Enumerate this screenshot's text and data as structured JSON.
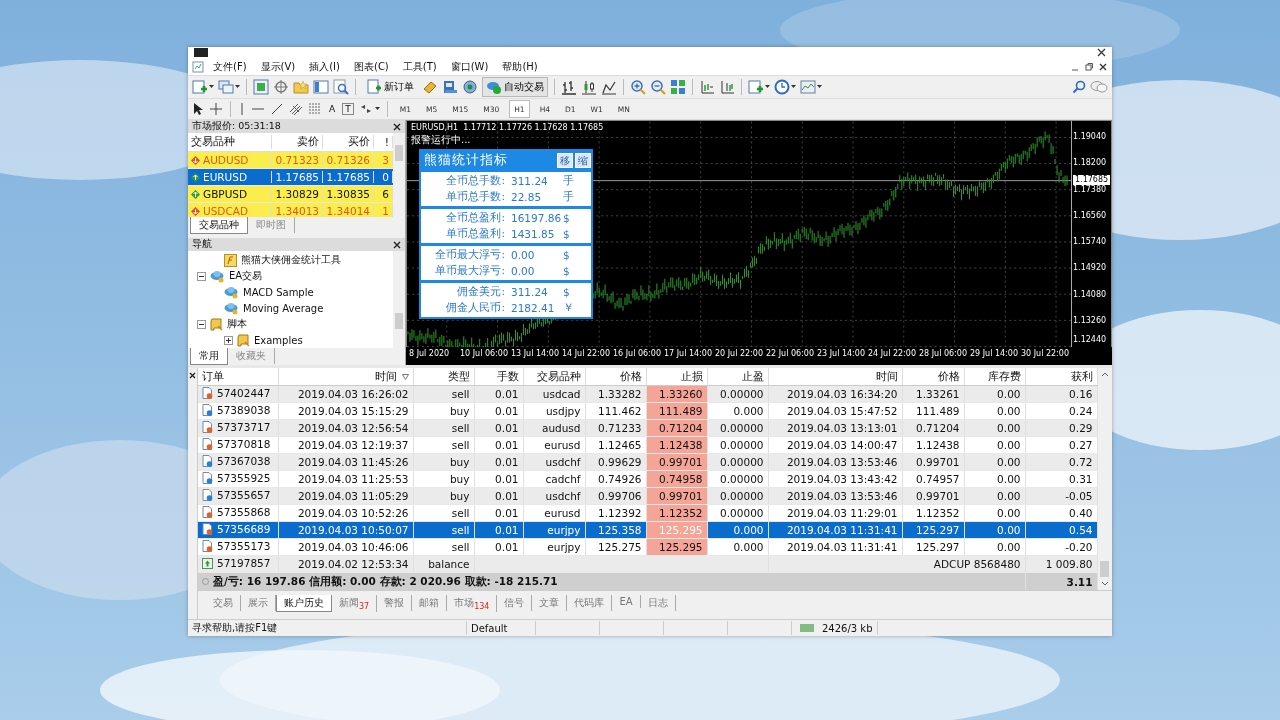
{
  "menu": [
    "文件(F)",
    "显示(V)",
    "插入(I)",
    "图表(C)",
    "工具(T)",
    "窗口(W)",
    "帮助(H)"
  ],
  "toolbar": {
    "new_order": "新订单",
    "auto_trading": {
      "label": "自动交易",
      "on": true
    }
  },
  "drawing_tools": {
    "text_tools": [
      "A",
      "T"
    ]
  },
  "timeframes": [
    {
      "label": "M1",
      "selected": false
    },
    {
      "label": "M5",
      "selected": false
    },
    {
      "label": "M15",
      "selected": false
    },
    {
      "label": "M30",
      "selected": false
    },
    {
      "label": "H1",
      "selected": true
    },
    {
      "label": "H4",
      "selected": false
    },
    {
      "label": "D1",
      "selected": false
    },
    {
      "label": "W1",
      "selected": false
    },
    {
      "label": "MN",
      "selected": false
    }
  ],
  "market_watch": {
    "title": "市场报价: 05:31:18",
    "columns": [
      "交易品种",
      "卖价",
      "买价",
      "!"
    ],
    "rows": [
      {
        "symbol": "AUDUSD",
        "bid": "0.71323",
        "ask": "0.71326",
        "spread": "3",
        "kind": "down",
        "selected": false
      },
      {
        "symbol": "EURUSD",
        "bid": "1.17685",
        "ask": "1.17685",
        "spread": "0",
        "kind": "up",
        "selected": true
      },
      {
        "symbol": "GBPUSD",
        "bid": "1.30829",
        "ask": "1.30835",
        "spread": "6",
        "kind": "up",
        "selected": false
      },
      {
        "symbol": "USDCAD",
        "bid": "1.34013",
        "ask": "1.34014",
        "spread": "1",
        "kind": "down",
        "selected": false
      }
    ],
    "tabs": [
      {
        "label": "交易品种",
        "selected": true
      },
      {
        "label": "即时图",
        "selected": false
      }
    ]
  },
  "navigator": {
    "title": "导航",
    "tree": [
      {
        "label": "熊猫大侠佣金统计工具",
        "kind": "indicator"
      },
      {
        "label": "EA交易",
        "kind": "expert",
        "expanded": true,
        "children": [
          {
            "label": "MACD Sample",
            "kind": "expert"
          },
          {
            "label": "Moving Average",
            "kind": "expert"
          }
        ]
      },
      {
        "label": "脚本",
        "kind": "script",
        "expanded": true,
        "children": [
          {
            "label": "Examples",
            "kind": "script",
            "expanded": false
          }
        ]
      }
    ],
    "tabs": [
      {
        "label": "常用",
        "selected": true
      },
      {
        "label": "收藏夹",
        "selected": false
      }
    ]
  },
  "chart": {
    "header": "EURUSD,H1  1.17712 1.17726 1.17628 1.17685",
    "status": "报警运行中...",
    "current_price": "1.17685",
    "price_labels": [
      "1.19040",
      "1.18200",
      "1.17380",
      "1.16560",
      "1.15740",
      "1.14920",
      "1.14080",
      "1.13260",
      "1.12440"
    ],
    "time_labels": [
      "8 Jul 2020",
      "10 Jul 06:00",
      "13 Jul 14:00",
      "14 Jul 22:00",
      "16 Jul 06:00",
      "17 Jul 14:00",
      "20 Jul 22:00",
      "22 Jul 06:00",
      "23 Jul 14:00",
      "24 Jul 22:00",
      "28 Jul 06:00",
      "29 Jul 14:00",
      "30 Jul 22:00"
    ]
  },
  "stats_panel": {
    "title": "熊猫统计指标",
    "buttons": [
      "移",
      "缩"
    ],
    "groups": [
      {
        "rows": [
          {
            "label": "全币总手数:",
            "value": "311.24",
            "unit": "手"
          },
          {
            "label": "单币总手数:",
            "value": "22.85",
            "unit": "手"
          }
        ]
      },
      {
        "rows": [
          {
            "label": "全币总盈利:",
            "value": "16197.86",
            "unit": "$"
          },
          {
            "label": "单币总盈利:",
            "value": "1431.85",
            "unit": "$"
          }
        ]
      },
      {
        "rows": [
          {
            "label": "全币最大浮亏:",
            "value": "0.00",
            "unit": "$"
          },
          {
            "label": "单币最大浮亏:",
            "value": "0.00",
            "unit": "$"
          }
        ]
      },
      {
        "rows": [
          {
            "label": "佣金美元:",
            "value": "311.24",
            "unit": "$"
          },
          {
            "label": "佣金人民币:",
            "value": "2182.41",
            "unit": "￥"
          }
        ]
      }
    ]
  },
  "terminal": {
    "columns": [
      "订单",
      "时间",
      "类型",
      "手数",
      "交易品种",
      "价格",
      "止损",
      "止盈",
      "时间",
      "价格",
      "库存费",
      "获利"
    ],
    "rows": [
      {
        "kind": "sell",
        "selected": false,
        "order": "57402447",
        "open_time": "2019.04.03 16:26:02",
        "type": "sell",
        "size": "0.01",
        "symbol": "usdcad",
        "price": "1.33282",
        "sl": "1.33260",
        "tp": "0.00000",
        "close_time": "2019.04.03 16:34:20",
        "close_price": "1.33261",
        "swap": "0.00",
        "profit": "0.16"
      },
      {
        "kind": "buy",
        "selected": false,
        "order": "57389038",
        "open_time": "2019.04.03 15:15:29",
        "type": "buy",
        "size": "0.01",
        "symbol": "usdjpy",
        "price": "111.462",
        "sl": "111.489",
        "tp": "0.000",
        "close_time": "2019.04.03 15:47:52",
        "close_price": "111.489",
        "swap": "0.00",
        "profit": "0.24"
      },
      {
        "kind": "sell",
        "selected": false,
        "order": "57373717",
        "open_time": "2019.04.03 12:56:54",
        "type": "sell",
        "size": "0.01",
        "symbol": "audusd",
        "price": "0.71233",
        "sl": "0.71204",
        "tp": "0.00000",
        "close_time": "2019.04.03 13:13:01",
        "close_price": "0.71204",
        "swap": "0.00",
        "profit": "0.29"
      },
      {
        "kind": "sell",
        "selected": false,
        "order": "57370818",
        "open_time": "2019.04.03 12:19:37",
        "type": "sell",
        "size": "0.01",
        "symbol": "eurusd",
        "price": "1.12465",
        "sl": "1.12438",
        "tp": "0.00000",
        "close_time": "2019.04.03 14:00:47",
        "close_price": "1.12438",
        "swap": "0.00",
        "profit": "0.27"
      },
      {
        "kind": "buy",
        "selected": false,
        "order": "57367038",
        "open_time": "2019.04.03 11:45:26",
        "type": "buy",
        "size": "0.01",
        "symbol": "usdchf",
        "price": "0.99629",
        "sl": "0.99701",
        "tp": "0.00000",
        "close_time": "2019.04.03 13:53:46",
        "close_price": "0.99701",
        "swap": "0.00",
        "profit": "0.72"
      },
      {
        "kind": "buy",
        "selected": false,
        "order": "57355925",
        "open_time": "2019.04.03 11:25:53",
        "type": "buy",
        "size": "0.01",
        "symbol": "cadchf",
        "price": "0.74926",
        "sl": "0.74958",
        "tp": "0.00000",
        "close_time": "2019.04.03 13:43:42",
        "close_price": "0.74957",
        "swap": "0.00",
        "profit": "0.31"
      },
      {
        "kind": "buy",
        "selected": false,
        "order": "57355657",
        "open_time": "2019.04.03 11:05:29",
        "type": "buy",
        "size": "0.01",
        "symbol": "usdchf",
        "price": "0.99706",
        "sl": "0.99701",
        "tp": "0.00000",
        "close_time": "2019.04.03 13:53:46",
        "close_price": "0.99701",
        "swap": "0.00",
        "profit": "-0.05"
      },
      {
        "kind": "sell",
        "selected": false,
        "order": "57355868",
        "open_time": "2019.04.03 10:52:26",
        "type": "sell",
        "size": "0.01",
        "symbol": "eurusd",
        "price": "1.12392",
        "sl": "1.12352",
        "tp": "0.00000",
        "close_time": "2019.04.03 11:29:01",
        "close_price": "1.12352",
        "swap": "0.00",
        "profit": "0.40"
      },
      {
        "kind": "sell",
        "selected": true,
        "order": "57356689",
        "open_time": "2019.04.03 10:50:07",
        "type": "sell",
        "size": "0.01",
        "symbol": "eurjpy",
        "price": "125.358",
        "sl": "125.295",
        "tp": "0.000",
        "close_time": "2019.04.03 11:31:41",
        "close_price": "125.297",
        "swap": "0.00",
        "profit": "0.54"
      },
      {
        "kind": "sell",
        "selected": false,
        "order": "57355173",
        "open_time": "2019.04.03 10:46:06",
        "type": "sell",
        "size": "0.01",
        "symbol": "eurjpy",
        "price": "125.275",
        "sl": "125.295",
        "tp": "0.000",
        "close_time": "2019.04.03 11:31:41",
        "close_price": "125.297",
        "swap": "0.00",
        "profit": "-0.20"
      },
      {
        "kind": "balance",
        "selected": false,
        "order": "57197857",
        "open_time": "2019.04.02 12:53:34",
        "type": "balance",
        "comment": "ADCUP 8568480",
        "profit": "1 009.80"
      }
    ],
    "summary": {
      "text": "盈/亏: 16 197.86  信用额: 0.00  存款: 2 020.96  取款: -18 215.71",
      "profit": "3.11"
    },
    "tabs": [
      {
        "label": "交易",
        "selected": false
      },
      {
        "label": "展示",
        "selected": false
      },
      {
        "label": "账户历史",
        "selected": true
      },
      {
        "label": "新闻",
        "badge": "37",
        "selected": false
      },
      {
        "label": "警报",
        "selected": false
      },
      {
        "label": "邮箱",
        "selected": false
      },
      {
        "label": "市场",
        "badge": "134",
        "selected": false
      },
      {
        "label": "信号",
        "selected": false
      },
      {
        "label": "文章",
        "selected": false
      },
      {
        "label": "代码库",
        "selected": false
      },
      {
        "label": "EA",
        "selected": false
      },
      {
        "label": "日志",
        "selected": false
      }
    ]
  },
  "status_bar": {
    "help": "寻求帮助,请按F1键",
    "profile": "Default",
    "traffic": "2426/3 kb"
  }
}
